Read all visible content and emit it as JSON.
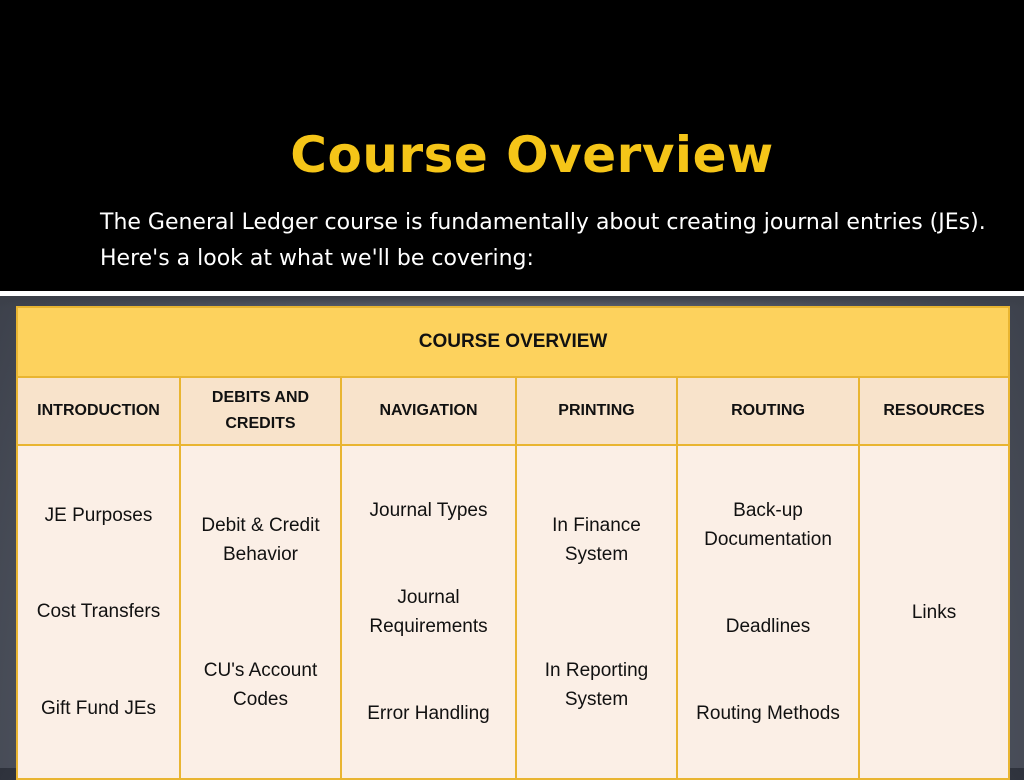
{
  "slide": {
    "title": "Course Overview",
    "subtitle": "The General Ledger course is fundamentally about creating journal entries (JEs). Here's a look at what we'll be covering:",
    "colors": {
      "title": "#f5c518",
      "table_header": "#fdd25d",
      "column_header": "#f8e3cb",
      "cell": "#fbefe6",
      "border": "#e9b531"
    }
  },
  "table": {
    "heading": "COURSE OVERVIEW",
    "columns": [
      {
        "label": "INTRODUCTION",
        "items": [
          "JE Purposes",
          "Cost Transfers",
          "Gift Fund JEs"
        ]
      },
      {
        "label": "DEBITS AND CREDITS",
        "items": [
          "Debit & Credit Behavior",
          "CU's Account Codes"
        ]
      },
      {
        "label": "NAVIGATION",
        "items": [
          "Journal Types",
          "Journal Requirements",
          "Error Handling"
        ]
      },
      {
        "label": "PRINTING",
        "items": [
          "In Finance System",
          "In Reporting System"
        ]
      },
      {
        "label": "ROUTING",
        "items": [
          "Back-up Documentation",
          "Deadlines",
          "Routing Methods"
        ]
      },
      {
        "label": "RESOURCES",
        "items": [
          "Links"
        ]
      }
    ]
  }
}
